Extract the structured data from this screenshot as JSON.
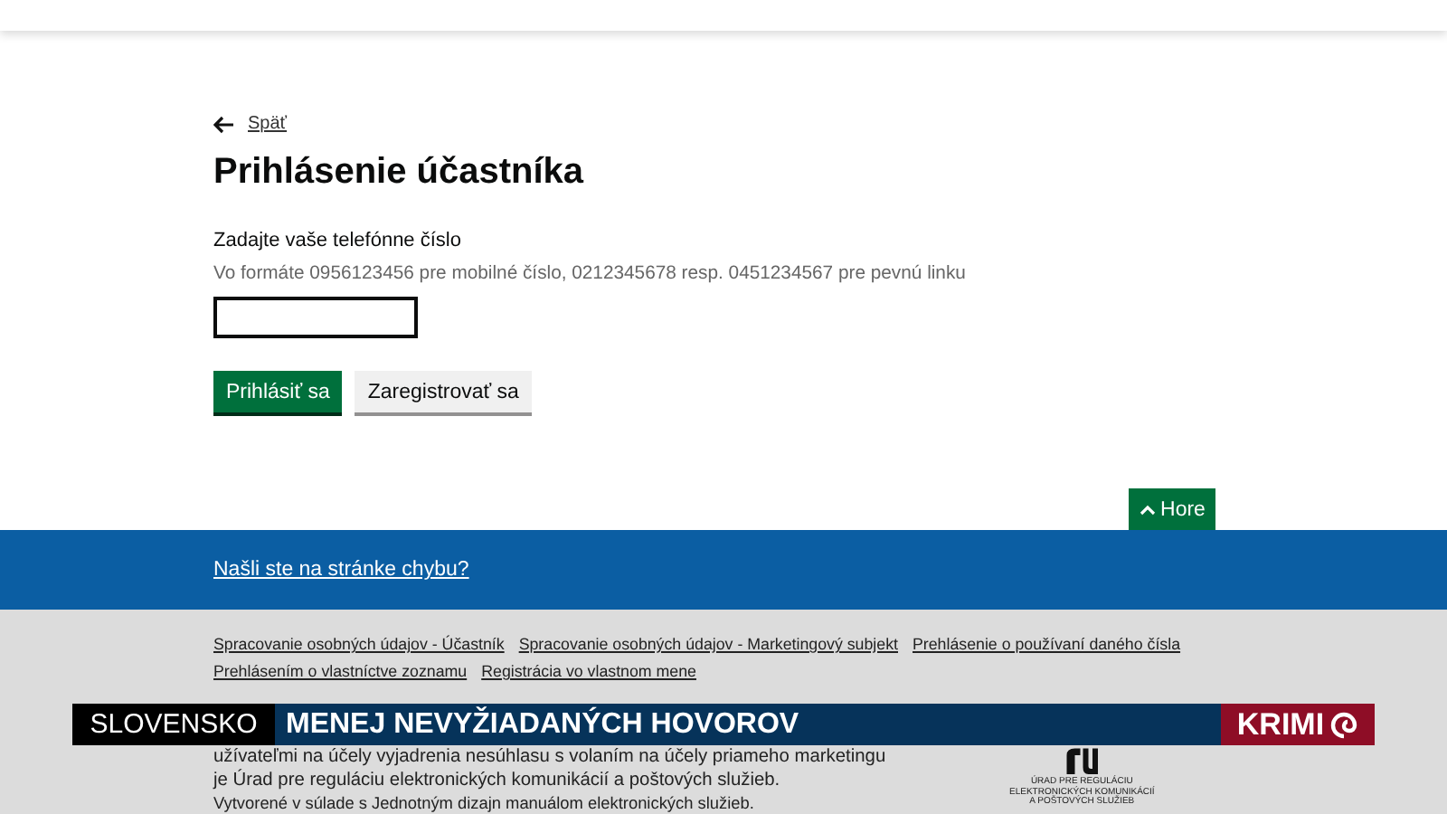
{
  "back_link": {
    "label": "Späť"
  },
  "title": "Prihlásenie účastníka",
  "phone_field": {
    "label": "Zadajte vaše telefónne číslo",
    "hint": "Vo formáte 0956123456 pre mobilné číslo, 0212345678 resp. 0451234567 pre pevnú linku"
  },
  "buttons": [
    {
      "label": "Prihlásiť sa",
      "kind": "primary"
    },
    {
      "label": "Zaregistrovať sa",
      "kind": "secondary"
    }
  ],
  "top_button": {
    "label": "Hore"
  },
  "feedback_link": "Našli ste na stránke chybu?",
  "footer": {
    "links": [
      {
        "label": "Spracovanie osobných údajov - Účastník"
      },
      {
        "label": "Spracovanie osobných údajov - Marketingový subjekt"
      },
      {
        "label": "Prehlásenie o používaní daného čísla"
      },
      {
        "label": "Prehlásením o vlastníctve zoznamu"
      },
      {
        "label": "Registrácia vo vlastnom mene"
      }
    ],
    "paragraph": "užívateľmi na účely vyjadrenia nesúhlasu s volaním na účely priameho marketingu je Úrad pre reguláciu elektronických komunikácií a poštových služieb.",
    "note": "Vytvorené v súlade s Jednotným dizajn manuálom elektronických služieb.",
    "logo_caption": [
      "ÚRAD PRE REGULÁCIU",
      "ELEKTRONICKÝCH KOMUNIKÁCIÍ",
      "A POŠTOVÝCH SLUŽIEB"
    ]
  },
  "ticker": {
    "region": "SLOVENSKO",
    "headline": "MENEJ NEVYŽIADANÝCH HOVOROV",
    "channel": "KRIMI"
  }
}
